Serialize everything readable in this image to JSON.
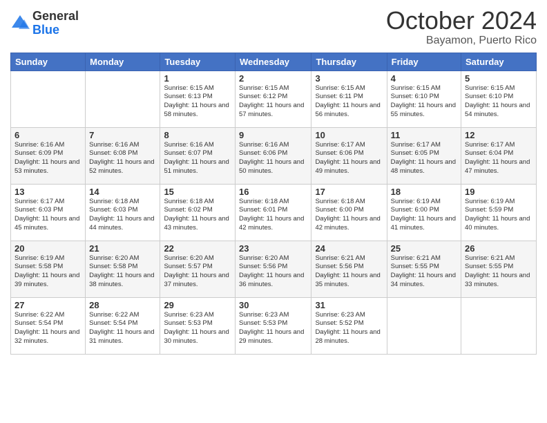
{
  "logo": {
    "general": "General",
    "blue": "Blue"
  },
  "header": {
    "month_year": "October 2024",
    "location": "Bayamon, Puerto Rico"
  },
  "weekdays": [
    "Sunday",
    "Monday",
    "Tuesday",
    "Wednesday",
    "Thursday",
    "Friday",
    "Saturday"
  ],
  "weeks": [
    [
      {
        "day": "",
        "sunrise": "",
        "sunset": "",
        "daylight": ""
      },
      {
        "day": "",
        "sunrise": "",
        "sunset": "",
        "daylight": ""
      },
      {
        "day": "1",
        "sunrise": "Sunrise: 6:15 AM",
        "sunset": "Sunset: 6:13 PM",
        "daylight": "Daylight: 11 hours and 58 minutes."
      },
      {
        "day": "2",
        "sunrise": "Sunrise: 6:15 AM",
        "sunset": "Sunset: 6:12 PM",
        "daylight": "Daylight: 11 hours and 57 minutes."
      },
      {
        "day": "3",
        "sunrise": "Sunrise: 6:15 AM",
        "sunset": "Sunset: 6:11 PM",
        "daylight": "Daylight: 11 hours and 56 minutes."
      },
      {
        "day": "4",
        "sunrise": "Sunrise: 6:15 AM",
        "sunset": "Sunset: 6:10 PM",
        "daylight": "Daylight: 11 hours and 55 minutes."
      },
      {
        "day": "5",
        "sunrise": "Sunrise: 6:15 AM",
        "sunset": "Sunset: 6:10 PM",
        "daylight": "Daylight: 11 hours and 54 minutes."
      }
    ],
    [
      {
        "day": "6",
        "sunrise": "Sunrise: 6:16 AM",
        "sunset": "Sunset: 6:09 PM",
        "daylight": "Daylight: 11 hours and 53 minutes."
      },
      {
        "day": "7",
        "sunrise": "Sunrise: 6:16 AM",
        "sunset": "Sunset: 6:08 PM",
        "daylight": "Daylight: 11 hours and 52 minutes."
      },
      {
        "day": "8",
        "sunrise": "Sunrise: 6:16 AM",
        "sunset": "Sunset: 6:07 PM",
        "daylight": "Daylight: 11 hours and 51 minutes."
      },
      {
        "day": "9",
        "sunrise": "Sunrise: 6:16 AM",
        "sunset": "Sunset: 6:06 PM",
        "daylight": "Daylight: 11 hours and 50 minutes."
      },
      {
        "day": "10",
        "sunrise": "Sunrise: 6:17 AM",
        "sunset": "Sunset: 6:06 PM",
        "daylight": "Daylight: 11 hours and 49 minutes."
      },
      {
        "day": "11",
        "sunrise": "Sunrise: 6:17 AM",
        "sunset": "Sunset: 6:05 PM",
        "daylight": "Daylight: 11 hours and 48 minutes."
      },
      {
        "day": "12",
        "sunrise": "Sunrise: 6:17 AM",
        "sunset": "Sunset: 6:04 PM",
        "daylight": "Daylight: 11 hours and 47 minutes."
      }
    ],
    [
      {
        "day": "13",
        "sunrise": "Sunrise: 6:17 AM",
        "sunset": "Sunset: 6:03 PM",
        "daylight": "Daylight: 11 hours and 45 minutes."
      },
      {
        "day": "14",
        "sunrise": "Sunrise: 6:18 AM",
        "sunset": "Sunset: 6:03 PM",
        "daylight": "Daylight: 11 hours and 44 minutes."
      },
      {
        "day": "15",
        "sunrise": "Sunrise: 6:18 AM",
        "sunset": "Sunset: 6:02 PM",
        "daylight": "Daylight: 11 hours and 43 minutes."
      },
      {
        "day": "16",
        "sunrise": "Sunrise: 6:18 AM",
        "sunset": "Sunset: 6:01 PM",
        "daylight": "Daylight: 11 hours and 42 minutes."
      },
      {
        "day": "17",
        "sunrise": "Sunrise: 6:18 AM",
        "sunset": "Sunset: 6:00 PM",
        "daylight": "Daylight: 11 hours and 42 minutes."
      },
      {
        "day": "18",
        "sunrise": "Sunrise: 6:19 AM",
        "sunset": "Sunset: 6:00 PM",
        "daylight": "Daylight: 11 hours and 41 minutes."
      },
      {
        "day": "19",
        "sunrise": "Sunrise: 6:19 AM",
        "sunset": "Sunset: 5:59 PM",
        "daylight": "Daylight: 11 hours and 40 minutes."
      }
    ],
    [
      {
        "day": "20",
        "sunrise": "Sunrise: 6:19 AM",
        "sunset": "Sunset: 5:58 PM",
        "daylight": "Daylight: 11 hours and 39 minutes."
      },
      {
        "day": "21",
        "sunrise": "Sunrise: 6:20 AM",
        "sunset": "Sunset: 5:58 PM",
        "daylight": "Daylight: 11 hours and 38 minutes."
      },
      {
        "day": "22",
        "sunrise": "Sunrise: 6:20 AM",
        "sunset": "Sunset: 5:57 PM",
        "daylight": "Daylight: 11 hours and 37 minutes."
      },
      {
        "day": "23",
        "sunrise": "Sunrise: 6:20 AM",
        "sunset": "Sunset: 5:56 PM",
        "daylight": "Daylight: 11 hours and 36 minutes."
      },
      {
        "day": "24",
        "sunrise": "Sunrise: 6:21 AM",
        "sunset": "Sunset: 5:56 PM",
        "daylight": "Daylight: 11 hours and 35 minutes."
      },
      {
        "day": "25",
        "sunrise": "Sunrise: 6:21 AM",
        "sunset": "Sunset: 5:55 PM",
        "daylight": "Daylight: 11 hours and 34 minutes."
      },
      {
        "day": "26",
        "sunrise": "Sunrise: 6:21 AM",
        "sunset": "Sunset: 5:55 PM",
        "daylight": "Daylight: 11 hours and 33 minutes."
      }
    ],
    [
      {
        "day": "27",
        "sunrise": "Sunrise: 6:22 AM",
        "sunset": "Sunset: 5:54 PM",
        "daylight": "Daylight: 11 hours and 32 minutes."
      },
      {
        "day": "28",
        "sunrise": "Sunrise: 6:22 AM",
        "sunset": "Sunset: 5:54 PM",
        "daylight": "Daylight: 11 hours and 31 minutes."
      },
      {
        "day": "29",
        "sunrise": "Sunrise: 6:23 AM",
        "sunset": "Sunset: 5:53 PM",
        "daylight": "Daylight: 11 hours and 30 minutes."
      },
      {
        "day": "30",
        "sunrise": "Sunrise: 6:23 AM",
        "sunset": "Sunset: 5:53 PM",
        "daylight": "Daylight: 11 hours and 29 minutes."
      },
      {
        "day": "31",
        "sunrise": "Sunrise: 6:23 AM",
        "sunset": "Sunset: 5:52 PM",
        "daylight": "Daylight: 11 hours and 28 minutes."
      },
      {
        "day": "",
        "sunrise": "",
        "sunset": "",
        "daylight": ""
      },
      {
        "day": "",
        "sunrise": "",
        "sunset": "",
        "daylight": ""
      }
    ]
  ]
}
